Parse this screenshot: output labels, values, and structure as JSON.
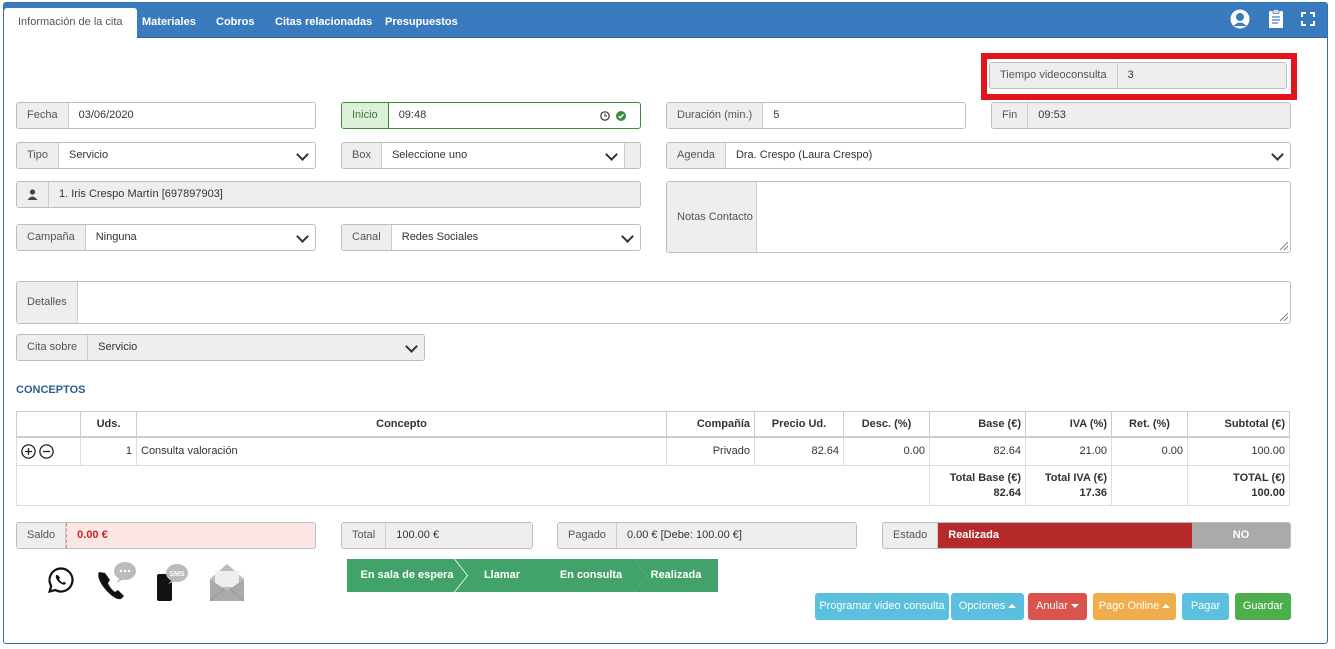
{
  "tabs": [
    {
      "label": "Información de la cita"
    },
    {
      "label": "Materiales"
    },
    {
      "label": "Cobros"
    },
    {
      "label": "Citas relacionadas"
    },
    {
      "label": "Presupuestos"
    }
  ],
  "videoconsulta": {
    "label": "Tiempo videoconsulta",
    "value": "3"
  },
  "fecha": {
    "label": "Fecha",
    "value": "03/06/2020"
  },
  "inicio": {
    "label": "Inicio",
    "value": "09:48"
  },
  "duracion": {
    "label": "Duración (min.)",
    "value": "5"
  },
  "fin": {
    "label": "Fin",
    "value": "09:53"
  },
  "tipo": {
    "label": "Tipo",
    "value": "Servicio"
  },
  "box": {
    "label": "Box",
    "value": "Seleccione uno"
  },
  "agenda": {
    "label": "Agenda",
    "value": "Dra. Crespo (Laura Crespo)"
  },
  "paciente": {
    "value": "1. Iris Crespo Martín [697897903]"
  },
  "notas": {
    "label": "Notas Contacto",
    "value": ""
  },
  "campana": {
    "label": "Campaña",
    "value": "Ninguna"
  },
  "canal": {
    "label": "Canal",
    "value": "Redes Sociales"
  },
  "detalles": {
    "label": "Detalles",
    "value": ""
  },
  "cita_sobre": {
    "label": "Cita sobre",
    "value": "Servicio"
  },
  "conceptos": {
    "title": "CONCEPTOS",
    "headers": [
      "",
      "Uds.",
      "Concepto",
      "Compañía",
      "Precio Ud.",
      "Desc. (%)",
      "Base (€)",
      "IVA (%)",
      "Ret. (%)",
      "Subtotal (€)"
    ],
    "row": {
      "uds": "1",
      "concepto": "Consulta valoración",
      "compania": "Privado",
      "precio": "82.64",
      "desc": "0.00",
      "base": "82.64",
      "iva": "21.00",
      "ret": "0.00",
      "subtotal": "100.00"
    },
    "totals": {
      "base_label": "Total Base (€)",
      "base": "82.64",
      "iva_label": "Total IVA (€)",
      "iva": "17.36",
      "total_label": "TOTAL (€)",
      "total": "100.00"
    }
  },
  "saldo": {
    "label": "Saldo",
    "value": "0.00 €"
  },
  "total": {
    "label": "Total",
    "value": "100.00 €"
  },
  "pagado": {
    "label": "Pagado",
    "value": "0.00 € [Debe: 100.00 €]"
  },
  "estado": {
    "label": "Estado",
    "value": "Realizada",
    "alt": "NO PRESENTADO"
  },
  "steps": [
    "En sala de espera",
    "Llamar",
    "En consulta",
    "Realizada"
  ],
  "buttons": {
    "programar": "Programar video consulta",
    "opciones": "Opciones",
    "anular": "Anular",
    "pago_online": "Pago Online",
    "pagar": "Pagar",
    "guardar": "Guardar"
  },
  "colors": {
    "topbar": "#3a7bc0",
    "step": "#41a36a",
    "estado": "#b52a2a",
    "programar": "#5bc0de",
    "anular": "#d9534f",
    "pago_online": "#f0ad4e",
    "pagar": "#5bc0de",
    "guardar": "#4cae4c"
  }
}
